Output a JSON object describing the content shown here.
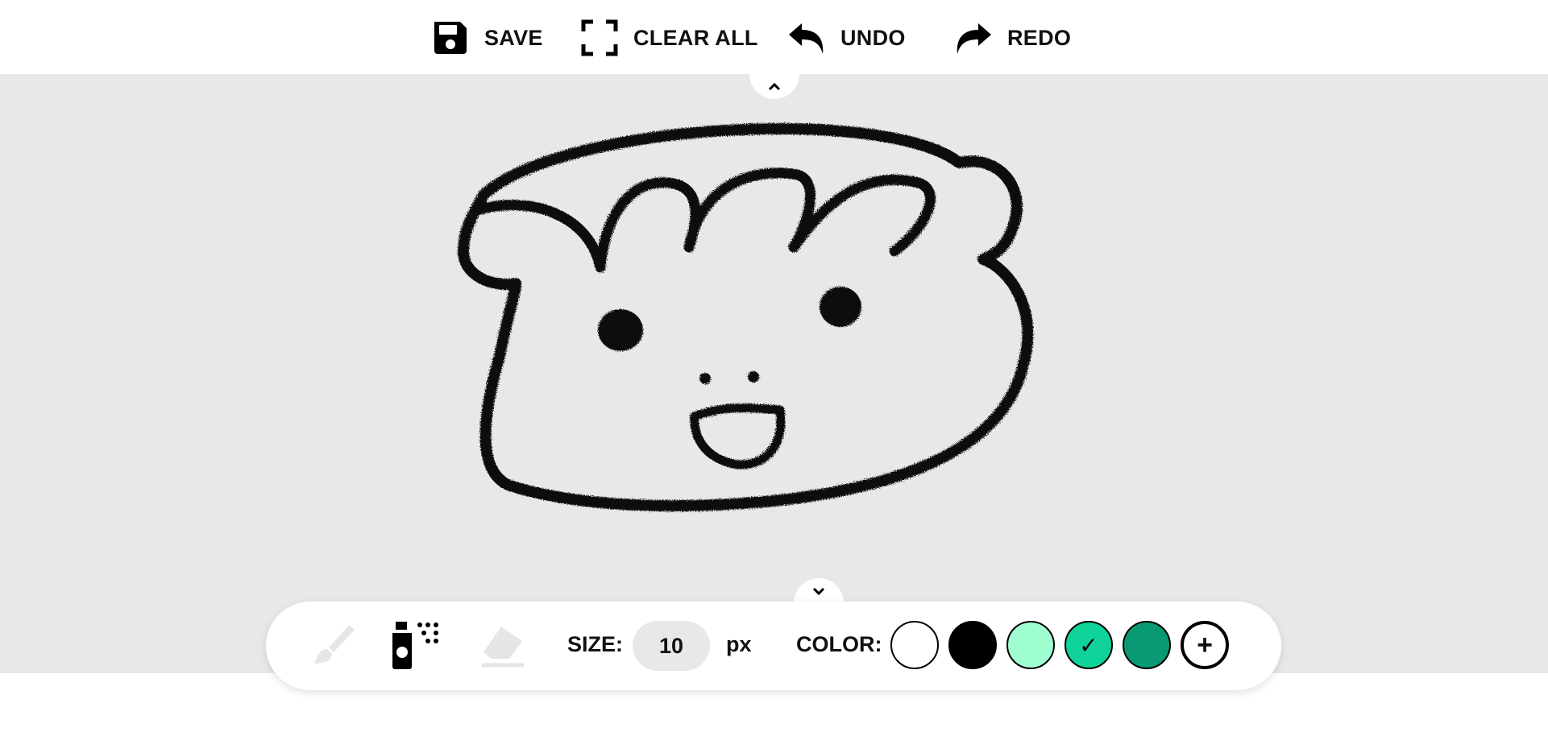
{
  "topbar": {
    "save_label": "SAVE",
    "clear_label": "CLEAR ALL",
    "undo_label": "UNDO",
    "redo_label": "REDO"
  },
  "tools": {
    "brush": {
      "icon": "paintbrush-icon",
      "active": false
    },
    "spray": {
      "icon": "spray-can-icon",
      "active": true
    },
    "eraser": {
      "icon": "eraser-icon",
      "active": false
    }
  },
  "size": {
    "label": "SIZE:",
    "value": "10",
    "unit": "px"
  },
  "color": {
    "label": "COLOR:",
    "swatches": [
      {
        "hex": "#ffffff",
        "selected": false
      },
      {
        "hex": "#000000",
        "selected": false
      },
      {
        "hex": "#a0ffd0",
        "selected": false
      },
      {
        "hex": "#10d39a",
        "selected": true
      },
      {
        "hex": "#0a9a73",
        "selected": false
      }
    ],
    "check_glyph": "✓",
    "add_glyph": "+"
  },
  "colors": {
    "canvas_bg": "#e8e8e8",
    "stroke": "#111111",
    "toolbar_bg": "#ffffff"
  }
}
